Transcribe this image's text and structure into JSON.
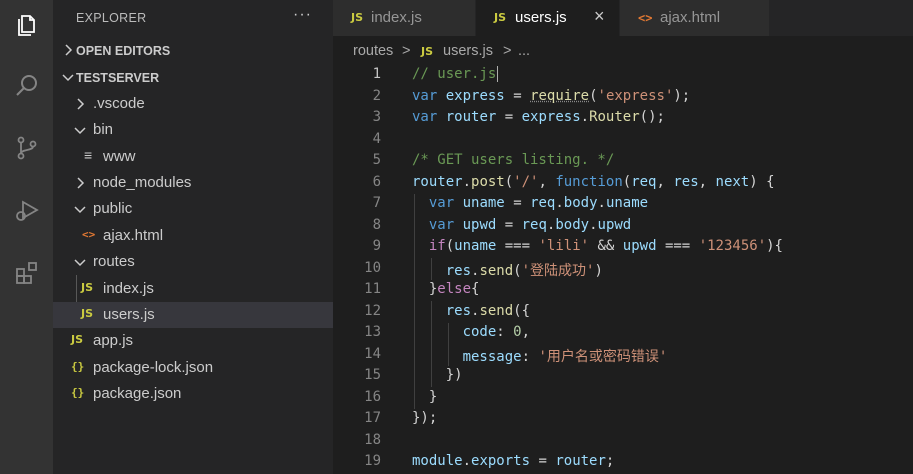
{
  "sidebar": {
    "title": "EXPLORER",
    "more": "···",
    "open_editors": "OPEN EDITORS",
    "project": "TESTSERVER",
    "tree": [
      {
        "label": ".vscode",
        "icon": "chevron-right",
        "type": "folder"
      },
      {
        "label": "bin",
        "icon": "chevron-down",
        "type": "folder"
      },
      {
        "label": "www",
        "icon": "≡",
        "type": "file"
      },
      {
        "label": "node_modules",
        "icon": "chevron-right",
        "type": "folder"
      },
      {
        "label": "public",
        "icon": "chevron-down",
        "type": "folder"
      },
      {
        "label": "ajax.html",
        "icon": "<>",
        "type": "file"
      },
      {
        "label": "routes",
        "icon": "chevron-down",
        "type": "folder"
      },
      {
        "label": "index.js",
        "icon": "JS",
        "type": "file"
      },
      {
        "label": "users.js",
        "icon": "JS",
        "type": "file",
        "selected": true
      },
      {
        "label": "app.js",
        "icon": "JS",
        "type": "file"
      },
      {
        "label": "package-lock.json",
        "icon": "{}",
        "type": "file"
      },
      {
        "label": "package.json",
        "icon": "{}",
        "type": "file"
      }
    ]
  },
  "tabs": [
    {
      "label": "index.js",
      "icon": "JS"
    },
    {
      "label": "users.js",
      "icon": "JS",
      "active": true,
      "close": "×"
    },
    {
      "label": "ajax.html",
      "icon": "<>"
    }
  ],
  "breadcrumb": {
    "folder": "routes",
    "sep1": ">",
    "file_icon": "JS",
    "file": "users.js",
    "sep2": ">",
    "more": "..."
  },
  "editor": {
    "line_numbers": [
      "1",
      "2",
      "3",
      "4",
      "5",
      "6",
      "7",
      "8",
      "9",
      "10",
      "11",
      "12",
      "13",
      "14",
      "15",
      "16",
      "17",
      "18",
      "19"
    ],
    "current_line": 1
  },
  "colors": {
    "keyword": "#569cd6",
    "variable": "#9cdcfe",
    "function": "#dcdcaa",
    "string": "#ce9178",
    "comment": "#6a9955",
    "control": "#c586c0",
    "number": "#b5cea8",
    "js_icon": "#cbcb41",
    "html_icon": "#e37933"
  },
  "icons": {
    "activity": [
      "files-icon",
      "search-icon",
      "source-control-icon",
      "run-debug-icon",
      "extensions-icon"
    ]
  }
}
